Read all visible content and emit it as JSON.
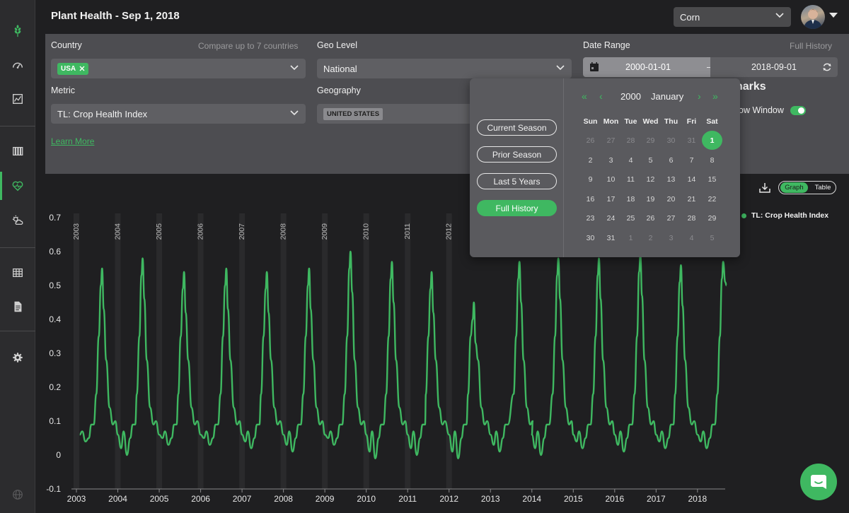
{
  "header": {
    "title": "Plant Health - Sep 1, 2018"
  },
  "crop_select": {
    "value": "Corn"
  },
  "icons": {
    "logo": "wheat-logo-icon",
    "nav": [
      "dashboard-gauge-icon",
      "chart-box-icon",
      "library-icon",
      "plant-health-heart-icon",
      "weather-sun-cloud-icon",
      "table-grid-icon",
      "document-icon",
      "settings-gear-icon"
    ]
  },
  "filters": {
    "country_label": "Country",
    "country_hint": "Compare up to 7 countries",
    "country_tag": "USA",
    "geo_level_label": "Geo Level",
    "geo_level_value": "National",
    "date_range_label": "Date Range",
    "date_range_hint": "Full History",
    "date_start": "2000-01-01",
    "date_dash": "–",
    "date_end": "2018-09-01",
    "metric_label": "Metric",
    "metric_value": "TL: Crop Health Index",
    "geography_label": "Geography",
    "geography_tag": "UNITED STATES",
    "learn_more": "Learn More",
    "benchmarks_partial": "narks",
    "show_window_partial": "ow Window"
  },
  "date_picker": {
    "presets": [
      "Current Season",
      "Prior Season",
      "Last 5 Years",
      "Full History"
    ],
    "active_preset": "Full History",
    "year": "2000",
    "month": "January",
    "weekdays": [
      "Sun",
      "Mon",
      "Tue",
      "Wed",
      "Thu",
      "Fri",
      "Sat"
    ],
    "weeks": [
      [
        "26",
        "27",
        "28",
        "29",
        "30",
        "31",
        "1"
      ],
      [
        "2",
        "3",
        "4",
        "5",
        "6",
        "7",
        "8"
      ],
      [
        "9",
        "10",
        "11",
        "12",
        "13",
        "14",
        "15"
      ],
      [
        "16",
        "17",
        "18",
        "19",
        "20",
        "21",
        "22"
      ],
      [
        "23",
        "24",
        "25",
        "26",
        "27",
        "28",
        "29"
      ],
      [
        "30",
        "31",
        "1",
        "2",
        "3",
        "4",
        "5"
      ]
    ],
    "selected_day": "1"
  },
  "view_toggle": {
    "graph": "Graph",
    "table": "Table",
    "active": "Graph"
  },
  "legend": {
    "label": "TL: Crop Health Index",
    "color": "#3fb861"
  },
  "colors": {
    "accent": "#3fb861",
    "background": "#1f1f21",
    "panel": "#4d4d51"
  },
  "chart_data": {
    "type": "line",
    "ylim": [
      -0.1,
      0.7
    ],
    "yticks": [
      "0.7",
      "0.6",
      "0.5",
      "0.4",
      "0.3",
      "0.2",
      "0.1",
      "0",
      "-0.1"
    ],
    "xlim": [
      2003,
      2018.72
    ],
    "xticks": [
      "2003",
      "2004",
      "2005",
      "2006",
      "2007",
      "2008",
      "2009",
      "2010",
      "2011",
      "2012",
      "2013",
      "2014",
      "2015",
      "2016",
      "2017",
      "2018"
    ],
    "season_markers": [
      "2003",
      "2004",
      "2005",
      "2006",
      "2007",
      "2008",
      "2009",
      "2010",
      "2011",
      "2012"
    ],
    "series": [
      {
        "name": "TL: Crop Health Index",
        "color": "#3fb861",
        "peaks": [
          {
            "year": 2003,
            "x": 2003.62,
            "value": 0.55,
            "low": 0.04
          },
          {
            "year": 2004,
            "x": 2004.6,
            "value": 0.58,
            "low": 0.0
          },
          {
            "year": 2005,
            "x": 2005.6,
            "value": 0.54,
            "low": 0.03
          },
          {
            "year": 2006,
            "x": 2006.62,
            "value": 0.55,
            "low": 0.03
          },
          {
            "year": 2007,
            "x": 2007.6,
            "value": 0.54,
            "low": 0.02
          },
          {
            "year": 2008,
            "x": 2008.62,
            "value": 0.55,
            "low": 0.01
          },
          {
            "year": 2009,
            "x": 2009.62,
            "value": 0.6,
            "low": 0.03
          },
          {
            "year": 2010,
            "x": 2010.62,
            "value": 0.57,
            "low": -0.01
          },
          {
            "year": 2011,
            "x": 2011.58,
            "value": 0.54,
            "low": 0.0
          },
          {
            "year": 2012,
            "x": 2012.6,
            "value": 0.45,
            "low": -0.01
          },
          {
            "year": 2013,
            "x": 2013.7,
            "value": 0.57,
            "low": 0.01
          },
          {
            "year": 2014,
            "x": 2014.64,
            "value": 0.58,
            "low": 0.0
          },
          {
            "year": 2015,
            "x": 2015.62,
            "value": 0.58,
            "low": 0.02
          },
          {
            "year": 2016,
            "x": 2016.62,
            "value": 0.59,
            "low": 0.01
          },
          {
            "year": 2017,
            "x": 2017.6,
            "value": 0.56,
            "low": 0.02
          },
          {
            "year": 2018,
            "x": 2018.62,
            "value": 0.57,
            "low": 0.02
          }
        ],
        "end_value": 0.5
      }
    ]
  }
}
